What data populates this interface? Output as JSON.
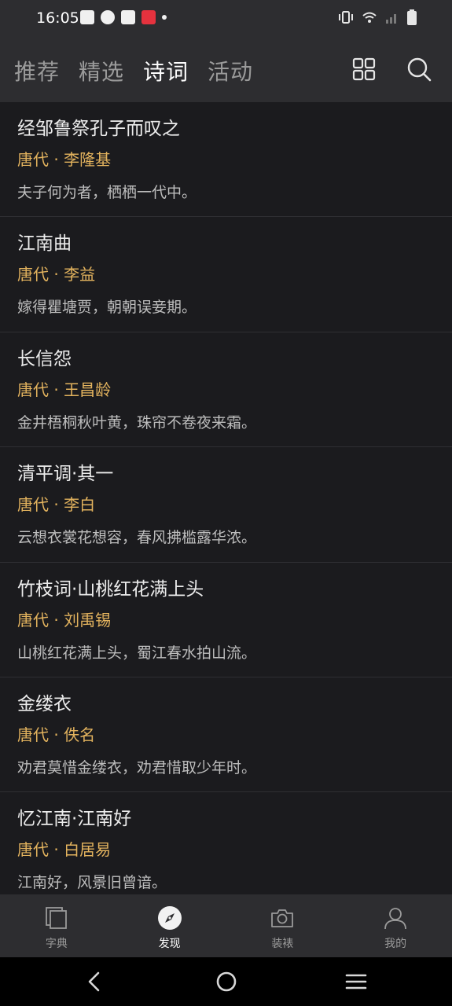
{
  "status_bar": {
    "time": "16:05"
  },
  "top_nav": {
    "tabs": [
      {
        "label": "推荐",
        "active": false
      },
      {
        "label": "精选",
        "active": false
      },
      {
        "label": "诗词",
        "active": true
      },
      {
        "label": "活动",
        "active": false
      }
    ],
    "icons": [
      "grid-icon",
      "search-icon"
    ]
  },
  "poems": [
    {
      "title": "经邹鲁祭孔子而叹之",
      "author": "唐代 · 李隆基",
      "line": "夫子何为者，栖栖一代中。"
    },
    {
      "title": "江南曲",
      "author": "唐代 · 李益",
      "line": "嫁得瞿塘贾，朝朝误妾期。"
    },
    {
      "title": "长信怨",
      "author": "唐代 · 王昌龄",
      "line": "金井梧桐秋叶黄，珠帘不卷夜来霜。"
    },
    {
      "title": "清平调·其一",
      "author": "唐代 · 李白",
      "line": "云想衣裳花想容，春风拂槛露华浓。"
    },
    {
      "title": "竹枝词·山桃红花满上头",
      "author": "唐代 · 刘禹锡",
      "line": "山桃红花满上头，蜀江春水拍山流。"
    },
    {
      "title": "金缕衣",
      "author": "唐代 · 佚名",
      "line": "劝君莫惜金缕衣，劝君惜取少年时。"
    },
    {
      "title": "忆江南·江南好",
      "author": "唐代 · 白居易",
      "line": "江南好，风景旧曾谙。"
    }
  ],
  "bottom_nav": {
    "items": [
      {
        "label": "字典",
        "icon": "dictionary-icon",
        "active": false
      },
      {
        "label": "发现",
        "icon": "compass-icon",
        "active": true
      },
      {
        "label": "装裱",
        "icon": "camera-icon",
        "active": false
      },
      {
        "label": "我的",
        "icon": "profile-icon",
        "active": false
      }
    ]
  },
  "colors": {
    "background": "#1b1b1e",
    "bar": "#2d2d30",
    "author_accent": "#e3b35e"
  }
}
